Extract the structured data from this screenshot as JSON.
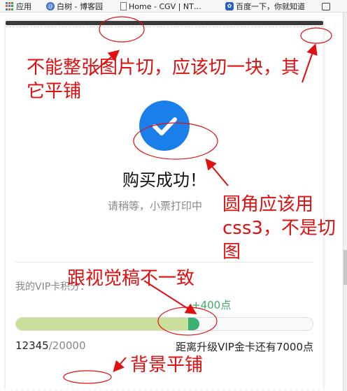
{
  "bookmarks": [
    {
      "label": "应用",
      "icon": "apps-grid-icon"
    },
    {
      "label": "白树 - 博客园",
      "icon": "blog-icon"
    },
    {
      "label": "Home - CGV | NT…",
      "icon": "page-icon"
    },
    {
      "label": "百度一下，你就知道",
      "icon": "baidu-paw-icon"
    }
  ],
  "receipt": {
    "title": "购买成功！",
    "subtitle": "请稍等，小票打印中",
    "vip_label": "我的VIP卡积分：",
    "points_gain": "+400点",
    "points_current": "12345",
    "points_max": "/20000",
    "progress_fraction": 0.6173,
    "upgrade_text": "距离升级VIP金卡还有7000点"
  },
  "annotations": {
    "note_1": "不能整张图片切，应该切一块，其它平铺",
    "note_2": "圆角应该用css3，不是切图",
    "note_3": "跟视觉稿不一致",
    "note_4": "背景平铺"
  },
  "colors": {
    "accent_blue": "#1a7fe8",
    "success_green": "#3daa6a",
    "progress_fill": "#c9df9a",
    "progress_head": "#3bb070",
    "annotation_red": "#e01010"
  }
}
